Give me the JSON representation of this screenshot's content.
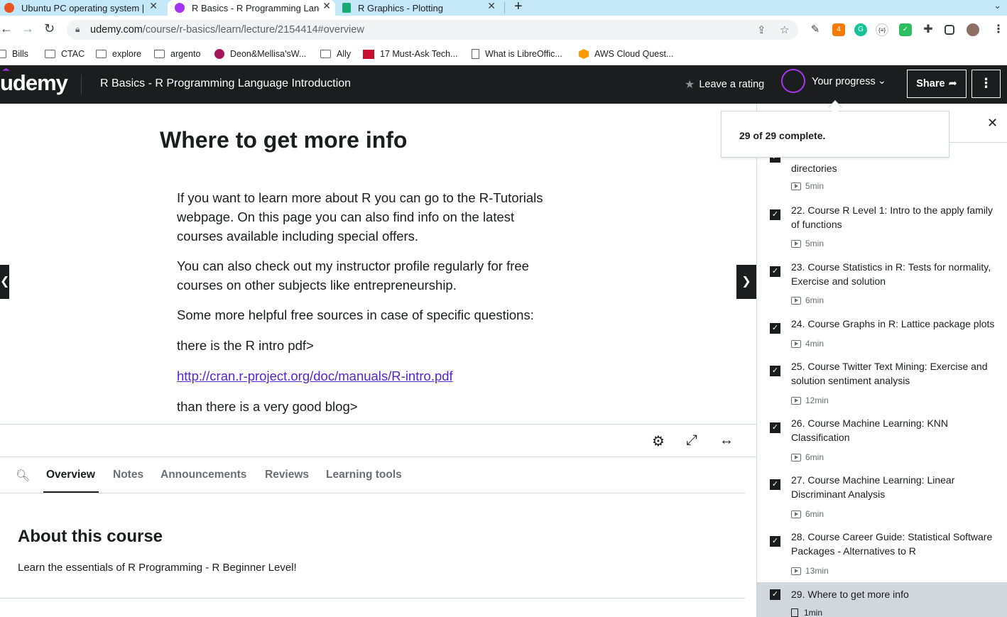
{
  "browser": {
    "tabs": [
      {
        "title": "Ubuntu PC operating system | ",
        "active": false
      },
      {
        "title": "R Basics - R Programming Lang",
        "active": true
      },
      {
        "title": "R Graphics - Plotting",
        "active": false
      }
    ],
    "url_domain": "udemy.com",
    "url_path": "/course/r-basics/learn/lecture/2154414#overview",
    "bookmarks": [
      "Bills",
      "CTAC",
      "explore",
      "argento",
      "Deon&Mellisa'sW...",
      "Ally",
      "17 Must-Ask Tech...",
      "What is LibreOffic...",
      "AWS Cloud Quest..."
    ],
    "extension_badge": "4",
    "extension_text": "{≡}"
  },
  "header": {
    "logo": "udemy",
    "course_title": "R Basics - R Programming Language Introduction",
    "rating_label": "Leave a rating",
    "progress_label": "Your progress",
    "share_label": "Share",
    "more_label": "⋮"
  },
  "progress_popover": {
    "text": "29 of 29 complete."
  },
  "lecture": {
    "title": "Where to get more info",
    "paragraphs": [
      "If you want to learn more about R you can go to the R-Tutorials webpage. On this page you can also find info on the latest courses available including special offers.",
      "You can also check out my instructor profile regularly for free courses on other subjects like entrepreneurship.",
      "Some more helpful free sources in case of specific questions:",
      "there is the R intro pdf>"
    ],
    "link": "http://cran.r-project.org/doc/manuals/R-intro.pdf",
    "last_paragraph": "than there is a very good blog>"
  },
  "course_tabs": [
    "Overview",
    "Notes",
    "Announcements",
    "Reviews",
    "Learning tools"
  ],
  "about": {
    "heading": "About this course",
    "text": "Learn the essentials of R Programming - R Beginner Level!"
  },
  "sidebar": {
    "partial_item": {
      "title_visible": "directories",
      "duration": "5min"
    },
    "items": [
      {
        "title": "22. Course R Level 1: Intro to the apply family of functions",
        "duration": "5min"
      },
      {
        "title": "23. Course Statistics in R: Tests for normality, Exercise and solution",
        "duration": "6min"
      },
      {
        "title": "24. Course Graphs in R: Lattice package plots",
        "duration": "4min"
      },
      {
        "title": "25. Course Twitter Text Mining: Exercise and solution sentiment analysis",
        "duration": "12min"
      },
      {
        "title": "26. Course Machine Learning: KNN Classification",
        "duration": "6min"
      },
      {
        "title": "27. Course Machine Learning: Linear Discriminant Analysis",
        "duration": "6min"
      },
      {
        "title": "28. Course Career Guide: Statistical Software Packages - Alternatives to R",
        "duration": "13min"
      },
      {
        "title": "29. Where to get more info",
        "duration": "1min"
      }
    ]
  },
  "colors": {
    "header_bg": "#1c1d1f",
    "accent": "#a435f0",
    "link": "#5624d0",
    "tabbar": "#c5e8f8"
  }
}
